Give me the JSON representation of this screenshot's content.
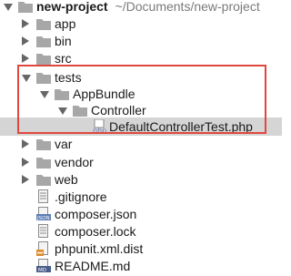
{
  "project": {
    "name": "new-project",
    "path": "~/Documents/new-project"
  },
  "tree": {
    "app": "app",
    "bin": "bin",
    "src": "src",
    "tests": "tests",
    "appbundle": "AppBundle",
    "controller": "Controller",
    "test_file": "DefaultControllerTest.php",
    "var": "var",
    "vendor": "vendor",
    "web": "web",
    "gitignore": ".gitignore",
    "composer_json": "composer.json",
    "composer_lock": "composer.lock",
    "phpunit": "phpunit.xml.dist",
    "readme": "README.md"
  },
  "icons": {
    "php_badge": "php",
    "json_badge": "JSON",
    "md_badge": "MD"
  },
  "colors": {
    "folder": "#a7a7a7",
    "selection": "#d5d5d5",
    "highlight_border": "#e0483f",
    "php_icon": "#6f76a9"
  }
}
